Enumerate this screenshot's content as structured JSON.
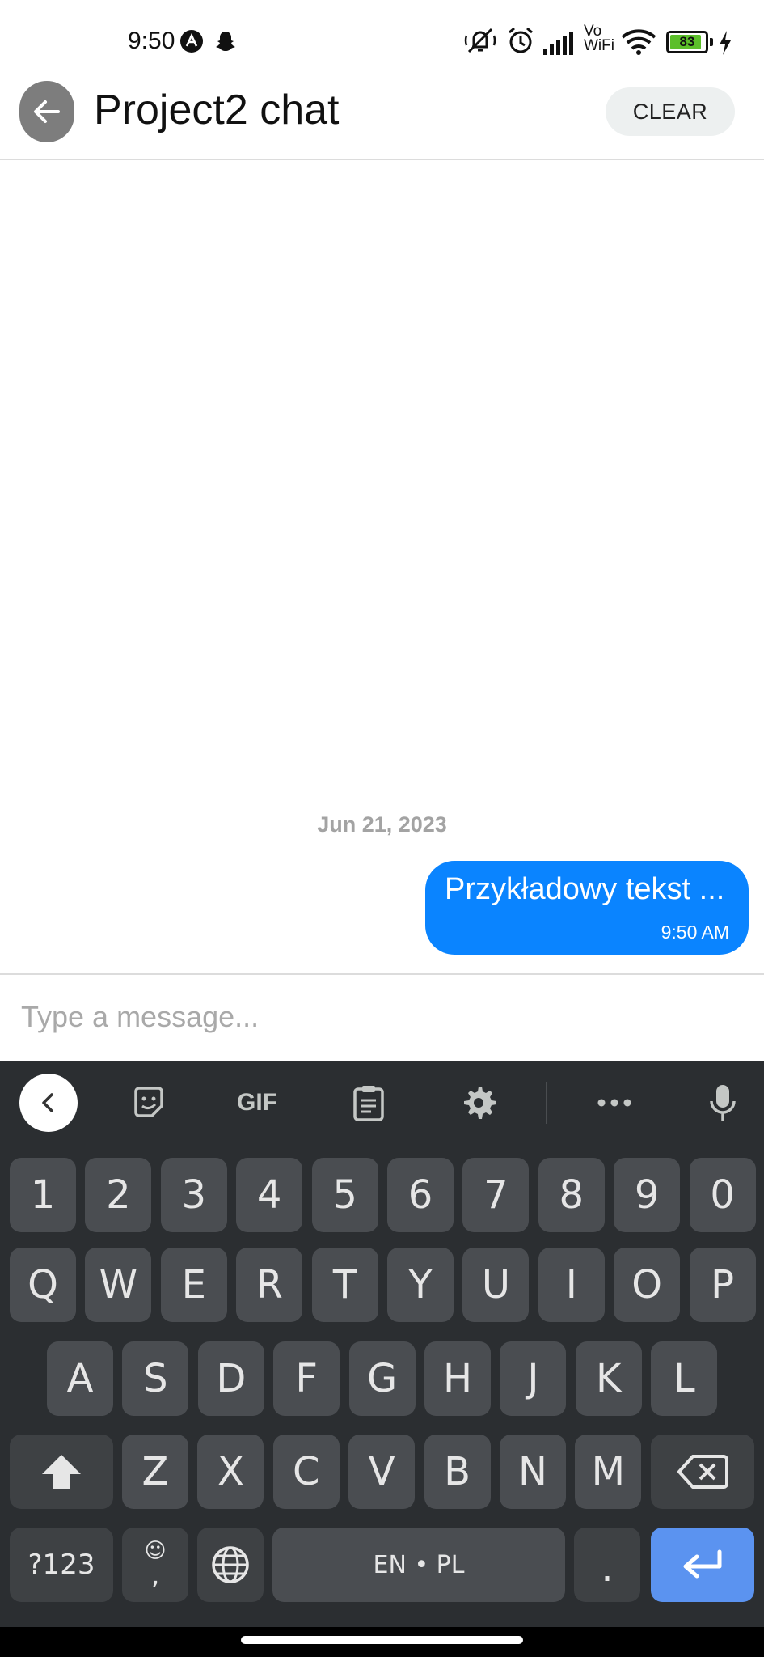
{
  "status_bar": {
    "time": "9:50",
    "battery_level": "83",
    "battery_fraction": 0.83,
    "icons": [
      "android-notification-icon",
      "snapchat-icon",
      "mute-icon",
      "alarm-icon",
      "signal-icon",
      "vowifi-icon",
      "wifi-icon",
      "battery-icon",
      "charging-icon"
    ],
    "vowifi_label_top": "Vo",
    "vowifi_label_bottom": "WiFi"
  },
  "app_bar": {
    "title": "Project2 chat",
    "clear_label": "CLEAR",
    "back_icon": "arrow-left-icon"
  },
  "chat": {
    "date_separator": "Jun 21, 2023",
    "messages": [
      {
        "text": "Przykładowy tekst ...",
        "time": "9:50 AM",
        "outgoing": true
      }
    ]
  },
  "composer": {
    "placeholder": "Type a message..."
  },
  "keyboard": {
    "toolbar": {
      "gif_label": "GIF",
      "icons": [
        "chevron-left-icon",
        "sticker-icon",
        "gif-icon",
        "clipboard-icon",
        "settings-icon",
        "more-icon",
        "microphone-icon"
      ]
    },
    "row_numbers": [
      "1",
      "2",
      "3",
      "4",
      "5",
      "6",
      "7",
      "8",
      "9",
      "0"
    ],
    "row_1": [
      "Q",
      "W",
      "E",
      "R",
      "T",
      "Y",
      "U",
      "I",
      "O",
      "P"
    ],
    "row_2": [
      "A",
      "S",
      "D",
      "F",
      "G",
      "H",
      "J",
      "K",
      "L"
    ],
    "row_3": [
      "Z",
      "X",
      "C",
      "V",
      "B",
      "N",
      "M"
    ],
    "symbols_label": "?123",
    "comma_label": ",",
    "space_label": "EN • PL",
    "period_label": ".",
    "colors": {
      "enter": "#5b93f0",
      "key": "#4a4d51",
      "background": "#2b2e31"
    }
  },
  "colors": {
    "bubble": "#0a84ff",
    "battery": "#5cbf2a"
  }
}
